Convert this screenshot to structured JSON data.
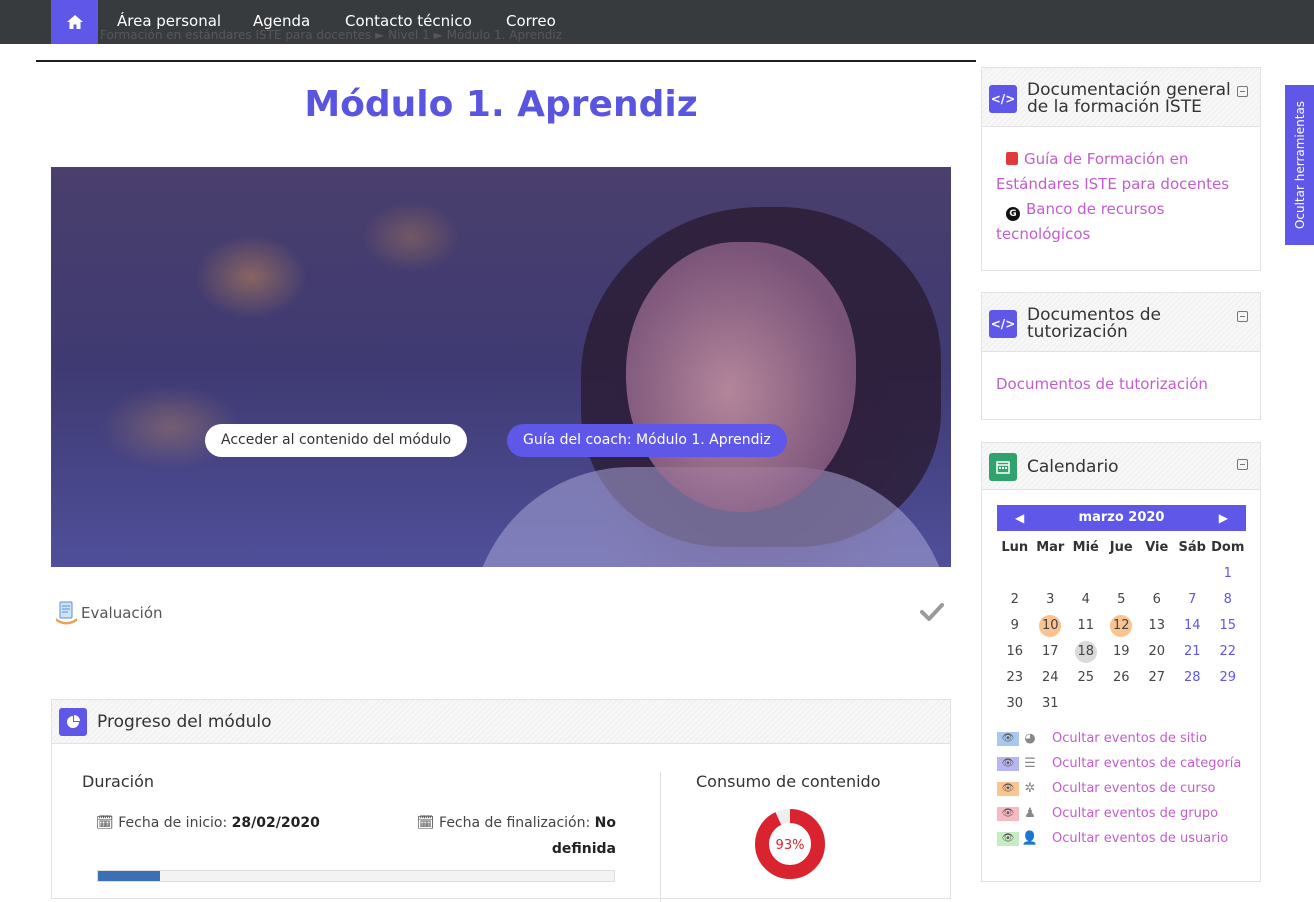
{
  "nav": {
    "items": [
      "Área personal",
      "Agenda",
      "Contacto técnico",
      "Correo"
    ],
    "breadcrumb_ghost": "Formación en estándares ISTE para docentes  ►  Nivel 1  ►  Módulo 1. Aprendiz"
  },
  "page": {
    "title": "Módulo 1. Aprendiz"
  },
  "hero": {
    "btn_access": "Acceder al contenido del módulo",
    "btn_guide": "Guía del coach: Módulo 1. Aprendiz"
  },
  "activity": {
    "label": "Evaluación"
  },
  "progress": {
    "title": "Progreso del módulo",
    "duration_label": "Duración",
    "start_label": "Fecha de inicio:",
    "start_value": "28/02/2020",
    "end_label": "Fecha de finalización:",
    "end_value_1": "No",
    "end_value_2": "definida",
    "consumption_label": "Consumo de contenido",
    "consumption_value": "93%",
    "consumption_fraction": 0.93,
    "bar_fraction": 0.12
  },
  "blocks": {
    "doc_general": {
      "title_1": "Documentación general",
      "title_2": "de la formación ISTE",
      "link1_a": "Guía de Formación en",
      "link1_b": "Estándares ISTE para docentes",
      "link2_a": "Banco de recursos",
      "link2_b": "tecnológicos"
    },
    "doc_tutor": {
      "title_1": "Documentos de",
      "title_2": "tutorización",
      "link": "Documentos de tutorización"
    },
    "calendar": {
      "title": "Calendario",
      "month": "marzo 2020",
      "days": [
        "Lun",
        "Mar",
        "Mié",
        "Jue",
        "Vie",
        "Sáb",
        "Dom"
      ],
      "weeks": [
        [
          "",
          "",
          "",
          "",
          "",
          "",
          "1"
        ],
        [
          "2",
          "3",
          "4",
          "5",
          "6",
          "7",
          "8"
        ],
        [
          "9",
          "10",
          "11",
          "12",
          "13",
          "14",
          "15"
        ],
        [
          "16",
          "17",
          "18",
          "19",
          "20",
          "21",
          "22"
        ],
        [
          "23",
          "24",
          "25",
          "26",
          "27",
          "28",
          "29"
        ],
        [
          "30",
          "31",
          "",
          "",
          "",
          "",
          ""
        ]
      ],
      "highlight_orange": [
        "10",
        "12"
      ],
      "highlight_today": "18",
      "legend": [
        {
          "label": "Ocultar eventos de sitio",
          "color": "#a9c8f0"
        },
        {
          "label": "Ocultar eventos de categoría",
          "color": "#b8b6f2"
        },
        {
          "label": "Ocultar eventos de curso",
          "color": "#fbc38f"
        },
        {
          "label": "Ocultar eventos de grupo",
          "color": "#f7b9c2"
        },
        {
          "label": "Ocultar eventos de usuario",
          "color": "#c5ecc2"
        }
      ]
    }
  },
  "sidetab": {
    "label": "Ocultar herramientas"
  },
  "colors": {
    "accent": "#5f57e8",
    "nav_bg": "#373b3e",
    "link": "#c45cd0",
    "donut": "#d9232e"
  }
}
